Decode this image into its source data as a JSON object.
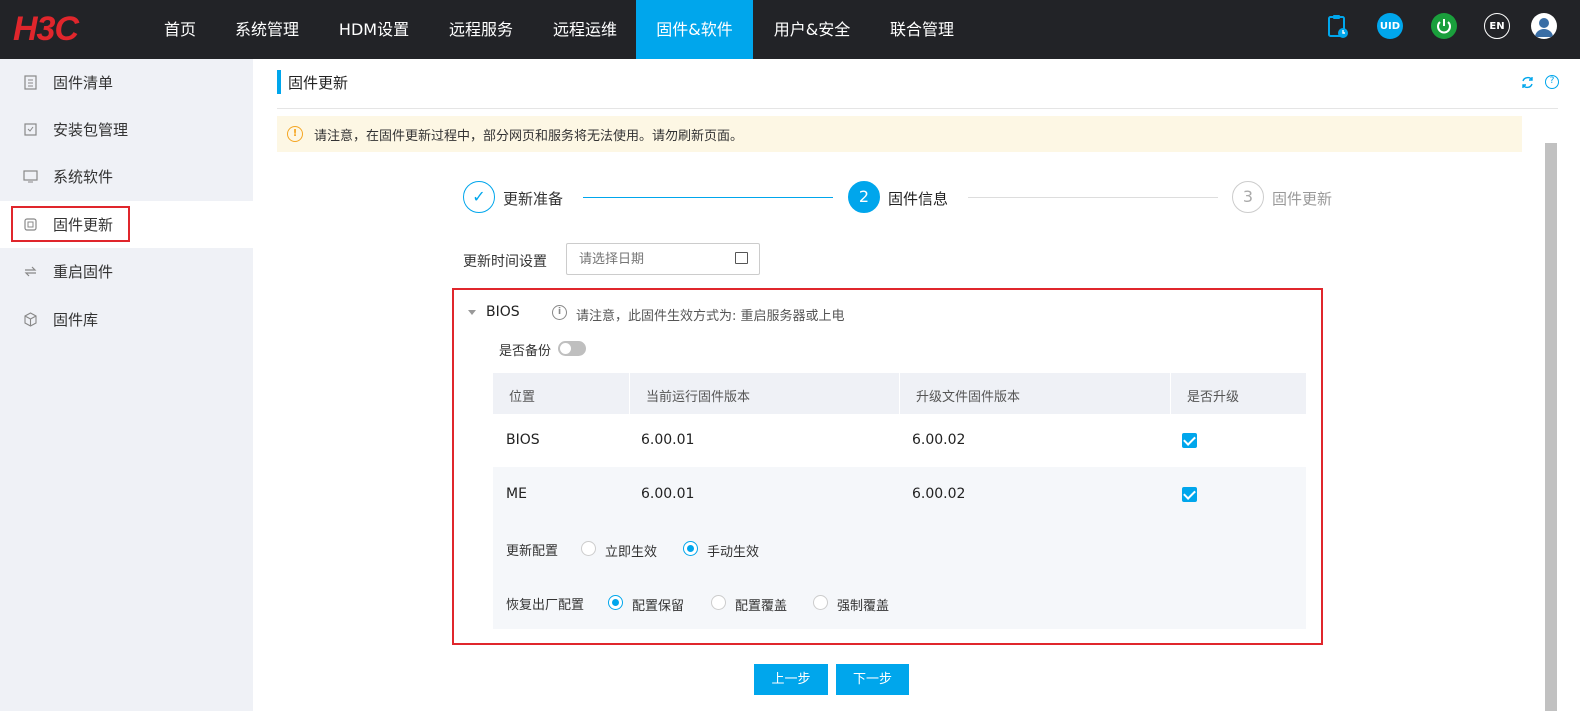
{
  "brand": {
    "logo_text": "H3C",
    "logo_color": "#e0262c"
  },
  "nav": {
    "items": [
      {
        "label": "首页"
      },
      {
        "label": "系统管理"
      },
      {
        "label": "HDM设置"
      },
      {
        "label": "远程服务"
      },
      {
        "label": "远程运维"
      },
      {
        "label": "固件&软件",
        "active": true
      },
      {
        "label": "用户&安全"
      },
      {
        "label": "联合管理"
      }
    ],
    "icons": {
      "uid": "UID",
      "lang": "EN",
      "clipboard": "clipboard-icon",
      "power": "power-icon",
      "user": "user-avatar-icon"
    }
  },
  "sidebar": {
    "items": [
      {
        "label": "固件清单",
        "icon": "list-icon"
      },
      {
        "label": "安装包管理",
        "icon": "package-icon"
      },
      {
        "label": "系统软件",
        "icon": "monitor-icon"
      },
      {
        "label": "固件更新",
        "icon": "chip-icon",
        "active": true
      },
      {
        "label": "重启固件",
        "icon": "restart-icon"
      },
      {
        "label": "固件库",
        "icon": "cube-icon"
      }
    ]
  },
  "page": {
    "title": "固件更新",
    "notice": "请注意，在固件更新过程中，部分网页和服务将无法使用。请勿刷新页面。"
  },
  "steps": [
    {
      "label": "更新准备",
      "state": "done",
      "mark": "✓"
    },
    {
      "label": "固件信息",
      "state": "active",
      "mark": "2"
    },
    {
      "label": "固件更新",
      "state": "pending",
      "mark": "3"
    }
  ],
  "schedule": {
    "label": "更新时间设置",
    "placeholder": "请选择日期"
  },
  "bios_panel": {
    "title": "BIOS",
    "info": "请注意，此固件生效方式为:  重启服务器或上电",
    "backup_label": "是否备份",
    "backup_on": false,
    "columns": [
      "位置",
      "当前运行固件版本",
      "升级文件固件版本",
      "是否升级"
    ],
    "rows": [
      {
        "location": "BIOS",
        "current": "6.00.01",
        "upgrade": "6.00.02",
        "checked": true
      },
      {
        "location": "ME",
        "current": "6.00.01",
        "upgrade": "6.00.02",
        "checked": true
      }
    ],
    "update_config": {
      "label": "更新配置",
      "options": [
        {
          "label": "立即生效",
          "selected": false
        },
        {
          "label": "手动生效",
          "selected": true
        }
      ]
    },
    "factory_config": {
      "label": "恢复出厂配置",
      "options": [
        {
          "label": "配置保留",
          "selected": true
        },
        {
          "label": "配置覆盖",
          "selected": false
        },
        {
          "label": "强制覆盖",
          "selected": false
        }
      ]
    }
  },
  "buttons": {
    "prev": "上一步",
    "next": "下一步"
  },
  "colors": {
    "accent": "#00a6ec",
    "nav_bg": "#222327",
    "highlight_border": "#e0262c",
    "power": "#1a9f3c"
  }
}
